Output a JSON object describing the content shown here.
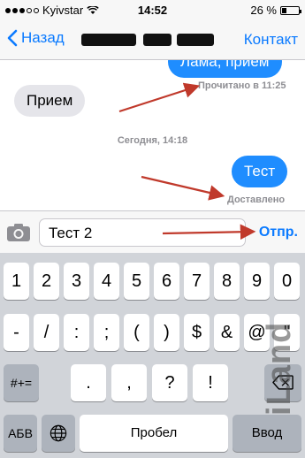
{
  "status_bar": {
    "carrier": "Kyivstar",
    "time": "14:52",
    "battery_text": "26 %",
    "battery_level": 0.26
  },
  "nav": {
    "back_label": "Назад",
    "contact_label": "Контакт"
  },
  "messages": {
    "top_partial": "Лама, прием",
    "read_receipt": "Прочитано в 11:25",
    "incoming": "Прием",
    "timestamp": "Сегодня, 14:18",
    "outgoing": "Тест",
    "delivered": "Доставлено"
  },
  "compose": {
    "value": "Тест 2",
    "send_label": "Отпр."
  },
  "keyboard": {
    "row1": [
      "1",
      "2",
      "3",
      "4",
      "5",
      "6",
      "7",
      "8",
      "9",
      "0"
    ],
    "row2": [
      "-",
      "/",
      ":",
      ";",
      "(",
      ")",
      "$",
      "&",
      "@",
      "\""
    ],
    "mode_key": "#+=",
    "row3": [
      ".",
      ",",
      "?",
      "!",
      "'"
    ],
    "abc_key": "АБВ",
    "space_label": "Пробел",
    "enter_label": "Ввод"
  },
  "watermark": "iLand",
  "colors": {
    "accent": "#0a7aff",
    "outgoing_bubble": "#1f8dff",
    "incoming_bubble": "#e5e5ea",
    "arrow": "#c0392b",
    "keyboard_bg": "#d1d4d9"
  }
}
